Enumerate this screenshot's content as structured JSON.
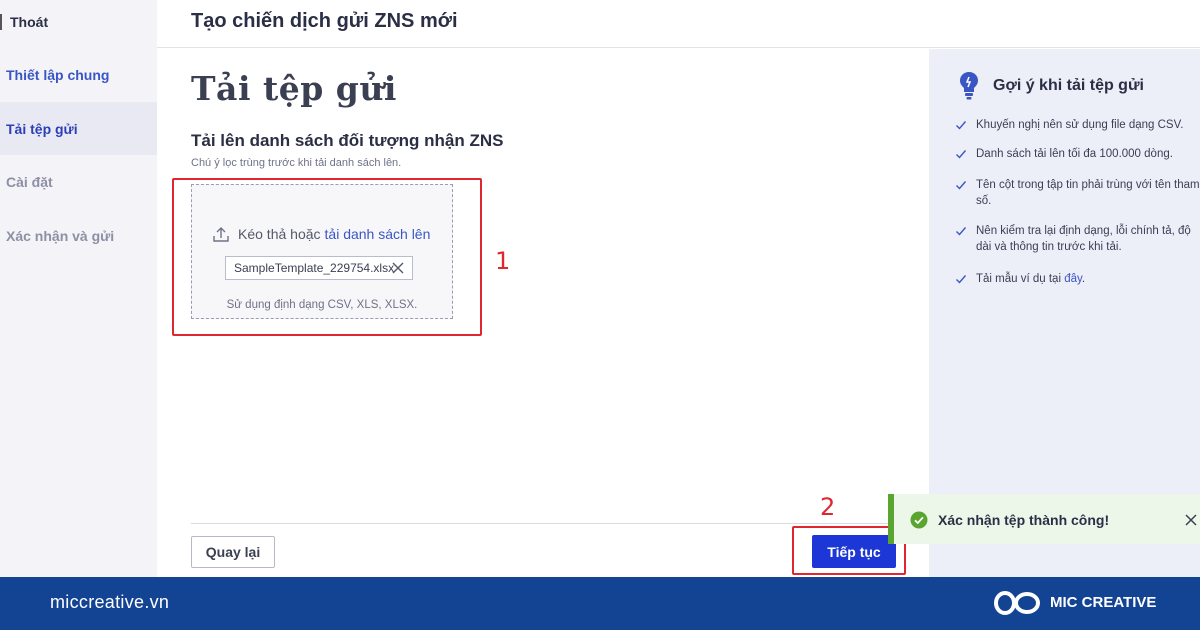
{
  "sidebar": {
    "exit_label": "Thoát",
    "steps": [
      {
        "label": "Thiết lập chung",
        "state": "done"
      },
      {
        "label": "Tải tệp gửi",
        "state": "active"
      },
      {
        "label": "Cài đặt",
        "state": "pending"
      },
      {
        "label": "Xác nhận và gửi",
        "state": "pending"
      }
    ]
  },
  "header": {
    "title": "Tạo chiến dịch gửi ZNS mới"
  },
  "main": {
    "page_title": "Tải tệp gửi",
    "section_title": "Tải lên danh sách đối tượng nhận ZNS",
    "section_note": "Chú ý lọc trùng trước khi tải danh sách lên.",
    "dropzone": {
      "prompt": "Kéo thả hoặc",
      "link": "tải danh sách lên",
      "file_name": "SampleTemplate_229754.xlsx",
      "formats": "Sử dụng định dạng CSV, XLS, XLSX."
    },
    "annotation_1": "1",
    "annotation_2": "2",
    "back_button": "Quay lại",
    "next_button": "Tiếp tục"
  },
  "hints": {
    "title": "Gợi ý khi tải tệp gửi",
    "items": [
      "Khuyến nghị nên sử dụng file dạng CSV.",
      "Danh sách tải lên tối đa 100.000 dòng.",
      "Tên cột trong tập tin phải trùng với tên tham số.",
      "Nên kiểm tra lại định dạng, lỗi chính tả, độ dài và thông tin trước khi tải."
    ],
    "sample_prefix": "Tải mẫu ví dụ tại",
    "sample_link": "đây",
    "sample_suffix": "."
  },
  "toast": {
    "message": "Xác nhận tệp thành công!"
  },
  "footer": {
    "site": "miccreative.vn",
    "brand": "MIC CREATIVE"
  },
  "colors": {
    "accent": "#1d37d6",
    "link": "#3a56c5",
    "annotation": "#e0262e",
    "success": "#5aa52f",
    "brand_bar": "#134494"
  },
  "icons": [
    "upload-icon",
    "close-icon",
    "lightbulb-icon",
    "check-icon",
    "success-check-icon",
    "brand-logo-icon"
  ]
}
